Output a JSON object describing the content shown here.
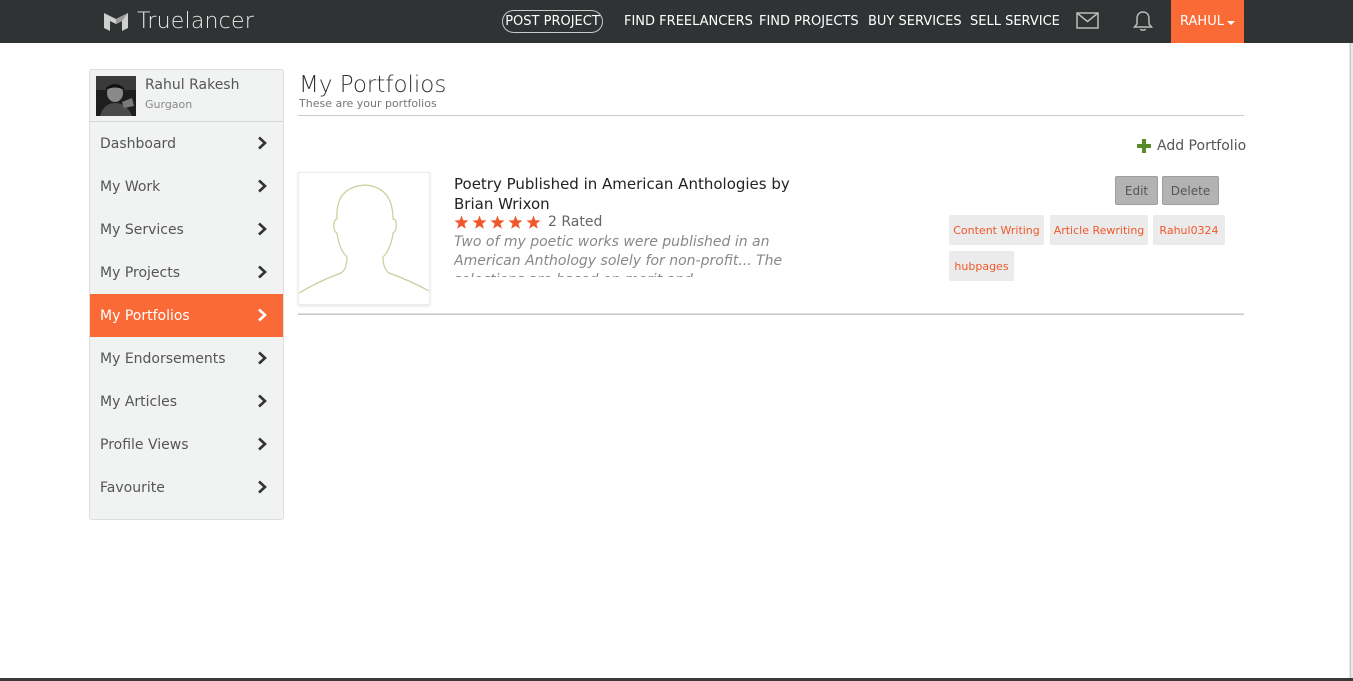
{
  "header": {
    "brand": "Truelancer",
    "post_project": "POST PROJECT",
    "links": [
      "FIND FREELANCERS",
      "FIND PROJECTS",
      "BUY SERVICES",
      "SELL SERVICE"
    ],
    "user_label": "RAHUL",
    "accent_color": "#f96a36",
    "bar_color": "#2f3334"
  },
  "sidebar": {
    "profile": {
      "name": "Rahul Rakesh",
      "location": "Gurgaon"
    },
    "items": [
      {
        "label": "Dashboard",
        "active": false
      },
      {
        "label": "My Work",
        "active": false
      },
      {
        "label": "My Services",
        "active": false
      },
      {
        "label": "My Projects",
        "active": false
      },
      {
        "label": "My Portfolios",
        "active": true
      },
      {
        "label": "My Endorsements",
        "active": false
      },
      {
        "label": "My Articles",
        "active": false
      },
      {
        "label": "Profile Views",
        "active": false
      },
      {
        "label": "Favourite",
        "active": false
      }
    ]
  },
  "main": {
    "title": "My Portfolios",
    "subtitle": "These are your portfolios",
    "add_label": "Add Portfolio",
    "portfolio": {
      "title": "Poetry Published in American Anthologies by Brian Wrixon",
      "stars": 5,
      "rated_text": "2 Rated",
      "description": "Two of my poetic works were published in an American Anthology solely for non-profit... The selections are based on merit and",
      "edit_label": "Edit",
      "delete_label": "Delete",
      "tags": [
        "Content Writing",
        "Article Rewriting",
        "Rahul0324",
        "hubpages"
      ]
    }
  }
}
